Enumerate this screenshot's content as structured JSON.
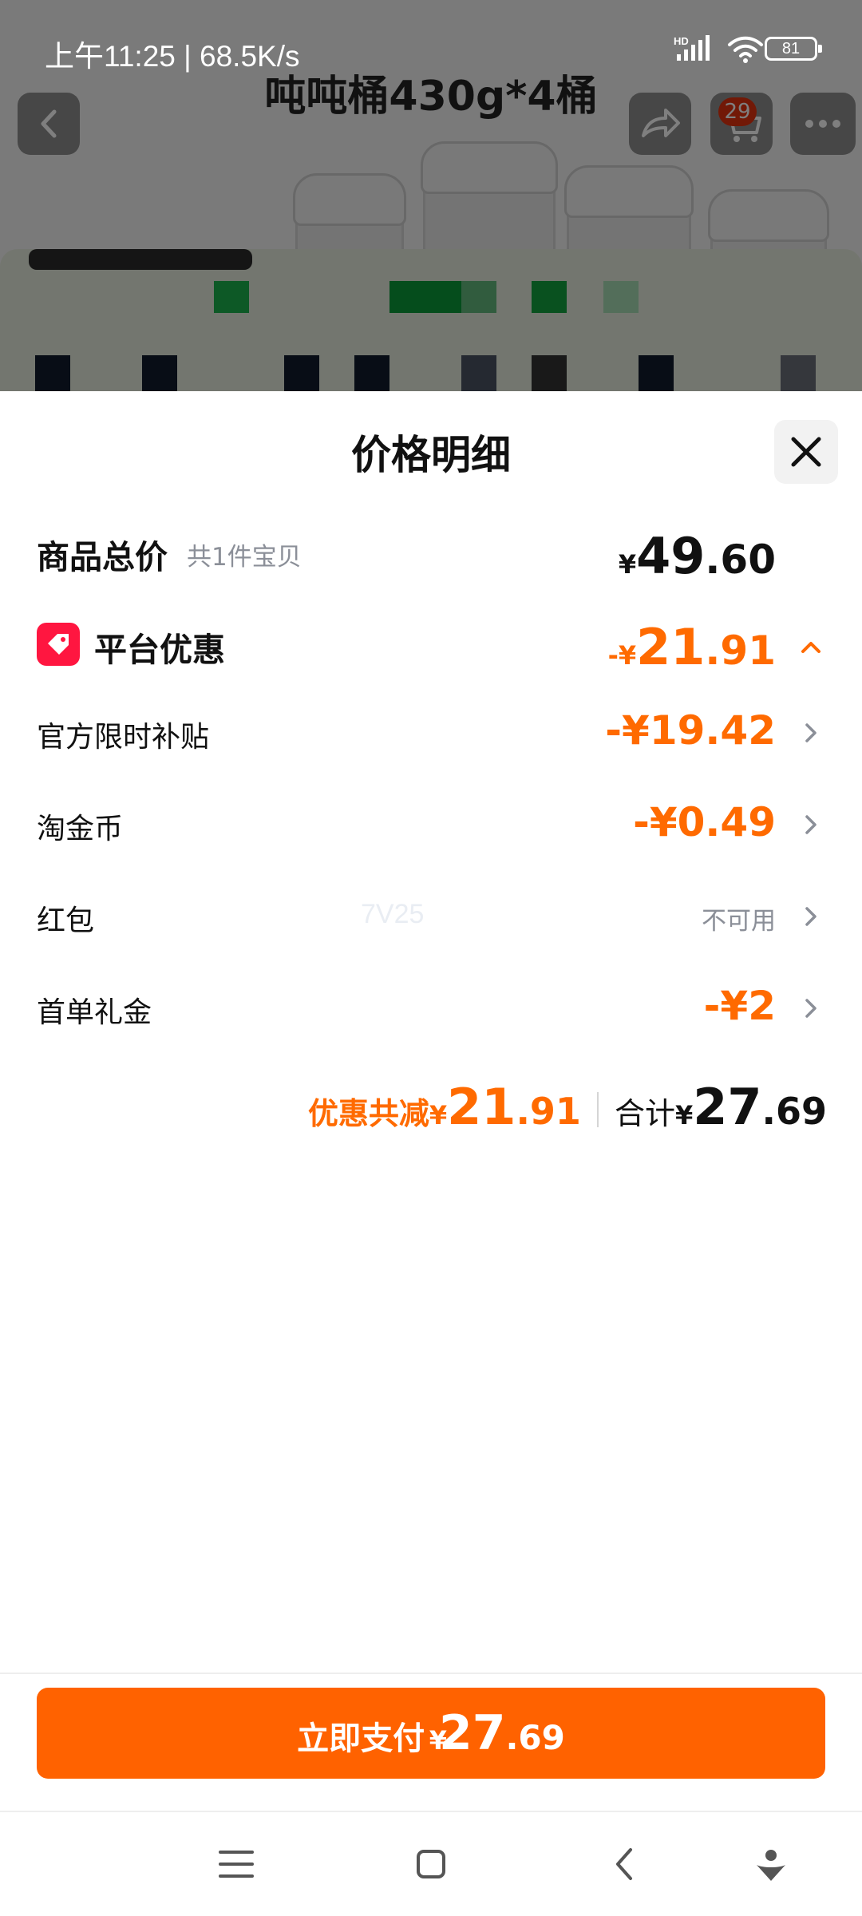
{
  "status_bar": {
    "time_speed": "上午11:25 | 68.5K/s",
    "battery": "81",
    "network": "HD"
  },
  "background_page": {
    "title": "吨吨桶430g*4桶",
    "cart_count": "29"
  },
  "sheet": {
    "title": "价格明细",
    "goods_total": {
      "label": "商品总价",
      "sub": "共1件宝贝",
      "currency": "¥",
      "amount_int": "49",
      "amount_dec": ".60"
    },
    "platform_discount": {
      "label": "平台优惠",
      "prefix": "-¥",
      "amount_int": "21",
      "amount_dec": ".91"
    },
    "items": [
      {
        "label": "官方限时补贴",
        "value": "-¥19.42"
      },
      {
        "label": "淘金币",
        "value": "-¥0.49"
      },
      {
        "label": "红包",
        "value": "不可用"
      },
      {
        "label": "首单礼金",
        "value": "-¥2"
      }
    ],
    "watermark": "7V25",
    "summary": {
      "discount_label": "优惠共减",
      "discount_currency": "¥",
      "discount_int": "21",
      "discount_dec": ".91",
      "total_label": "合计",
      "total_currency": "¥",
      "total_int": "27",
      "total_dec": ".69"
    }
  },
  "pay_button": {
    "label": "立即支付",
    "currency": "¥",
    "amount_int": "27",
    "amount_dec": ".69"
  },
  "colors": {
    "accent": "#ff6200",
    "discount_text": "#ff6a00",
    "tag": "#ff1640"
  },
  "icons": [
    "back-arrow-icon",
    "share-icon",
    "cart-icon",
    "more-icon",
    "close-icon",
    "tag-icon",
    "chevron-up-icon",
    "chevron-right-icon",
    "menu-icon",
    "home-icon",
    "back-icon",
    "assistant-icon"
  ]
}
